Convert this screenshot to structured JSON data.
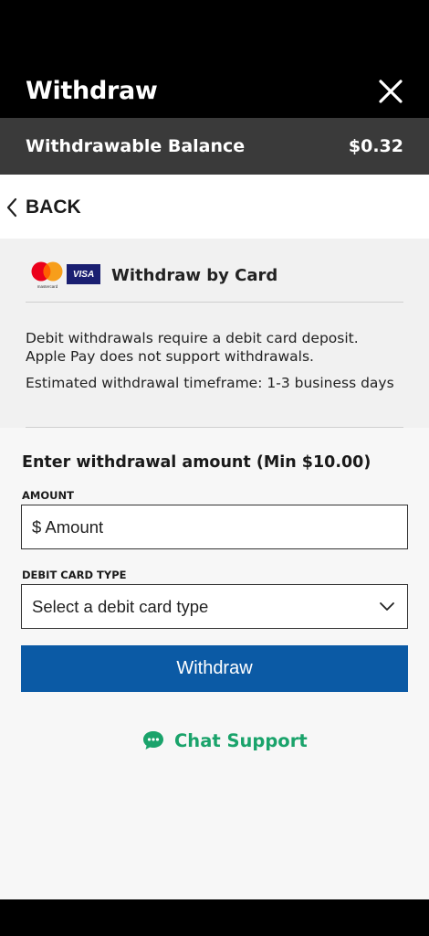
{
  "header": {
    "title": "Withdraw",
    "close_icon": "close-icon"
  },
  "balance": {
    "label": "Withdrawable Balance",
    "value": "$0.32"
  },
  "back": {
    "label": "BACK",
    "icon": "chevron-left-icon"
  },
  "card_section": {
    "title": "Withdraw by Card",
    "mastercard_text": "mastercard",
    "visa_text": "VISA",
    "info": "Debit withdrawals require a debit card deposit. Apple Pay does not support withdrawals.",
    "timeframe": "Estimated withdrawal timeframe: 1-3 business days"
  },
  "form": {
    "heading": "Enter withdrawal amount (Min $10.00)",
    "amount_label": "AMOUNT",
    "amount_placeholder": "$ Amount",
    "card_type_label": "DEBIT CARD TYPE",
    "card_type_selected": "Select a debit card type",
    "submit_label": "Withdraw"
  },
  "support": {
    "label": "Chat Support",
    "icon": "chat-bubble-icon"
  },
  "colors": {
    "header_bg": "#000000",
    "balance_bg": "#3a3a3a",
    "primary_button": "#0b5aa5",
    "chat_green": "#1aa36b"
  }
}
